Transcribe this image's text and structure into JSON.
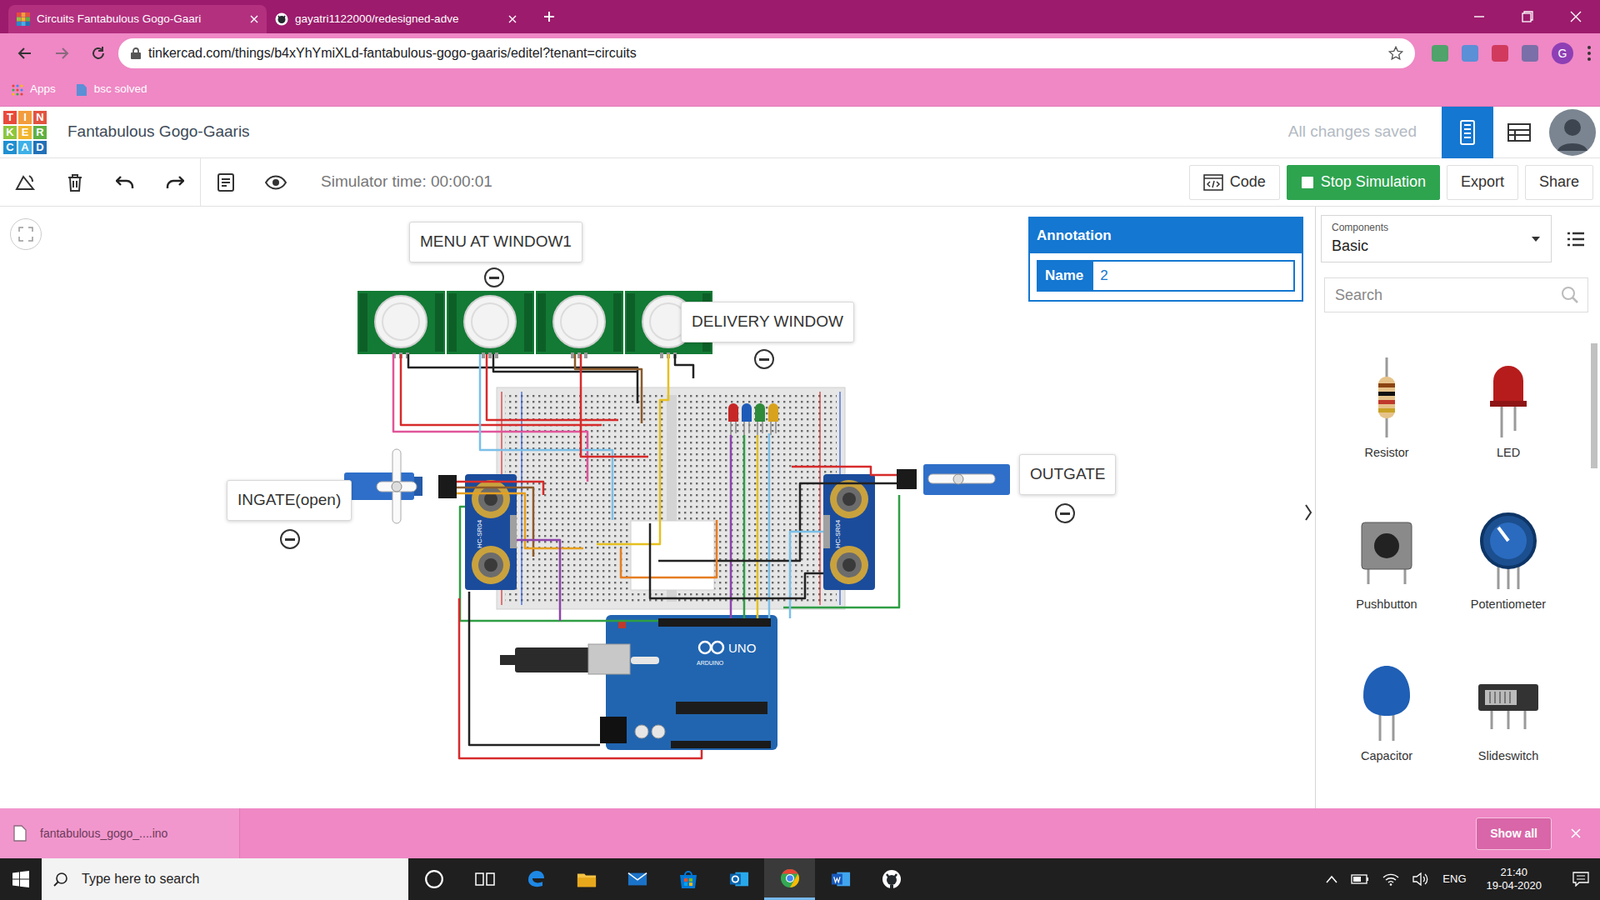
{
  "browser": {
    "tabs": [
      {
        "label": "Circuits Fantabulous Gogo-Gaari",
        "selected": true
      },
      {
        "label": "gayatri1122000/redesigned-adve",
        "selected": false
      }
    ],
    "url": "tinkercad.com/things/b4xYhYmiXLd-fantabulous-gogo-gaaris/editel?tenant=circuits",
    "profile": "G",
    "bookmarks": [
      "Apps",
      "bsc solved"
    ]
  },
  "app": {
    "logo": [
      {
        "letter": "T",
        "color": "#e84a3c"
      },
      {
        "letter": "I",
        "color": "#f39c3c"
      },
      {
        "letter": "N",
        "color": "#e2533f"
      },
      {
        "letter": "K",
        "color": "#8dc63f"
      },
      {
        "letter": "E",
        "color": "#f1b52e"
      },
      {
        "letter": "R",
        "color": "#5fb043"
      },
      {
        "letter": "C",
        "color": "#1f8fd0"
      },
      {
        "letter": "A",
        "color": "#3fb0e8"
      },
      {
        "letter": "D",
        "color": "#2271b8"
      }
    ],
    "title": "Fantabulous Gogo-Gaaris",
    "save_status": "All changes saved"
  },
  "toolbar": {
    "sim_time": "Simulator time: 00:00:01",
    "buttons": [
      {
        "label": "Code",
        "kind": "code"
      },
      {
        "label": "Stop Simulation",
        "kind": "stop"
      },
      {
        "label": "Export",
        "kind": "plain"
      },
      {
        "label": "Share",
        "kind": "plain"
      }
    ]
  },
  "canvas": {
    "callouts": [
      {
        "text": "MENU AT WINDOW1"
      },
      {
        "text": "DELIVERY WINDOW"
      },
      {
        "text": "INGATE(open)"
      },
      {
        "text": "OUTGATE"
      }
    ],
    "leds": [
      {
        "color": "#c62828"
      },
      {
        "color": "#1e5bb8"
      },
      {
        "color": "#2e8b3a"
      },
      {
        "color": "#d8a21c"
      }
    ],
    "board": {
      "model": "UNO",
      "brand": "ARDUINO"
    },
    "sensors": [
      {
        "label": "HC-SR04"
      },
      {
        "label": "HC-SR04"
      }
    ]
  },
  "annotation": {
    "title": "Annotation",
    "field_label": "Name",
    "value": "2"
  },
  "components": {
    "label": "Components",
    "category": "Basic",
    "search_placeholder": "Search",
    "items": [
      {
        "name": "Resistor",
        "kind": "resistor"
      },
      {
        "name": "LED",
        "kind": "led"
      },
      {
        "name": "Pushbutton",
        "kind": "pushbutton"
      },
      {
        "name": "Potentiometer",
        "kind": "potentiometer"
      },
      {
        "name": "Capacitor",
        "kind": "capacitor"
      },
      {
        "name": "Slideswitch",
        "kind": "slideswitch"
      }
    ]
  },
  "downloads": {
    "file": "fantabulous_gogo_....ino",
    "show_all": "Show all"
  },
  "taskbar": {
    "search": "Type here to search",
    "language": "ENG",
    "time": "21:40",
    "date": "19-04-2020"
  }
}
